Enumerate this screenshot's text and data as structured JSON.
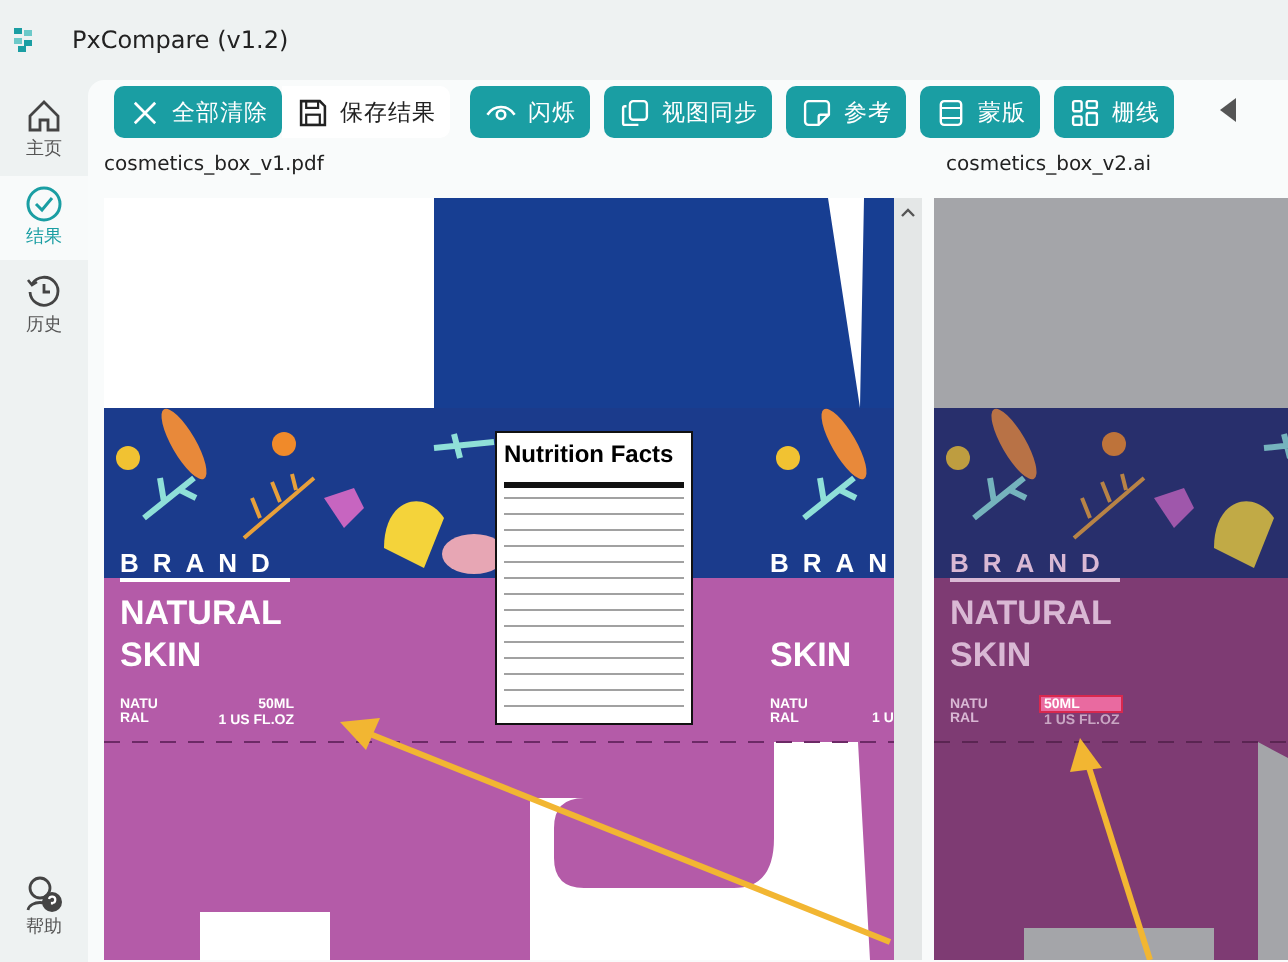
{
  "window": {
    "title": "PxCompare (v1.2)"
  },
  "sidebar": {
    "items": [
      {
        "label": "主页",
        "selected": false
      },
      {
        "label": "结果",
        "selected": true
      },
      {
        "label": "历史",
        "selected": false
      }
    ],
    "help": {
      "label": "帮助"
    }
  },
  "toolbar": {
    "buttons": [
      {
        "label": "全部清除",
        "kind": "primary"
      },
      {
        "label": "保存结果",
        "kind": "plain"
      },
      {
        "label": "闪烁",
        "kind": "primary"
      },
      {
        "label": "视图同步",
        "kind": "primary"
      },
      {
        "label": "参考",
        "kind": "primary"
      },
      {
        "label": "蒙版",
        "kind": "primary"
      },
      {
        "label": "栅线",
        "kind": "primary"
      }
    ]
  },
  "panes": [
    {
      "file_name": "cosmetics_box_v1.pdf",
      "kind": "original",
      "artwork": {
        "brand": "BRAND",
        "title": [
          "NATURAL",
          "SKIN"
        ],
        "variant": [
          "NATU",
          "RAL"
        ],
        "volume": [
          "50ML",
          "1 US FL.OZ"
        ],
        "nutrition_title": "Nutrition Facts",
        "repeat": {
          "brand": "BRAN",
          "title": "SKIN",
          "variant": [
            "NATU",
            "RAL"
          ],
          "volume": "1 U"
        }
      }
    },
    {
      "file_name": "cosmetics_box_v2.ai",
      "kind": "dimmed",
      "artwork": {
        "brand": "BRAND",
        "title": [
          "NATURAL",
          "SKIN"
        ],
        "variant": [
          "NATU",
          "RAL"
        ],
        "volume": [
          "50ML",
          "1 US FL.OZ"
        ],
        "highlight": true
      }
    }
  ]
}
